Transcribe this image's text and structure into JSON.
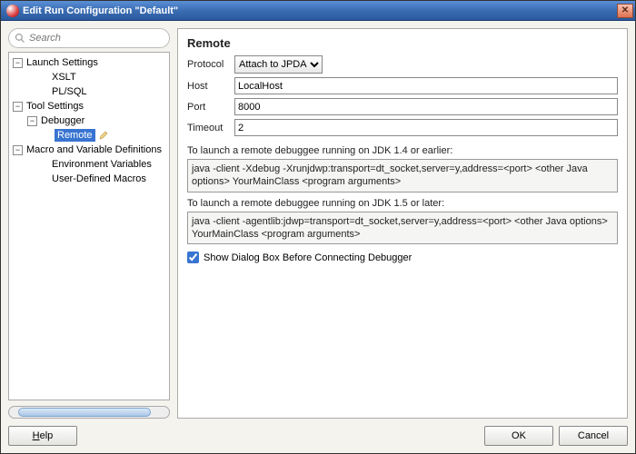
{
  "titlebar": {
    "title": "Edit Run Configuration \"Default\""
  },
  "search": {
    "placeholder": "Search"
  },
  "tree": {
    "launch_settings": "Launch Settings",
    "xslt": "XSLT",
    "plsql": "PL/SQL",
    "tool_settings": "Tool Settings",
    "debugger": "Debugger",
    "remote": "Remote",
    "macro_var": "Macro and Variable Definitions",
    "env_vars": "Environment Variables",
    "user_macros": "User-Defined Macros"
  },
  "pane": {
    "title": "Remote",
    "protocol_label": "Protocol",
    "protocol_value": "Attach to JPDA",
    "host_label": "Host",
    "host_value": "LocalHost",
    "port_label": "Port",
    "port_value": "8000",
    "timeout_label": "Timeout",
    "timeout_value": "2",
    "instr14": "To launch a remote debuggee running on JDK 1.4 or earlier:",
    "cmd14": "java -client -Xdebug -Xrunjdwp:transport=dt_socket,server=y,address=<port> <other Java options> YourMainClass <program arguments>",
    "instr15": "To launch a remote debuggee running on JDK 1.5 or later:",
    "cmd15": "java -client -agentlib:jdwp=transport=dt_socket,server=y,address=<port> <other Java options> YourMainClass <program arguments>",
    "show_dialog_label": "Show Dialog Box Before Connecting Debugger",
    "show_dialog_checked": true
  },
  "footer": {
    "help": "Help",
    "ok": "OK",
    "cancel": "Cancel"
  }
}
